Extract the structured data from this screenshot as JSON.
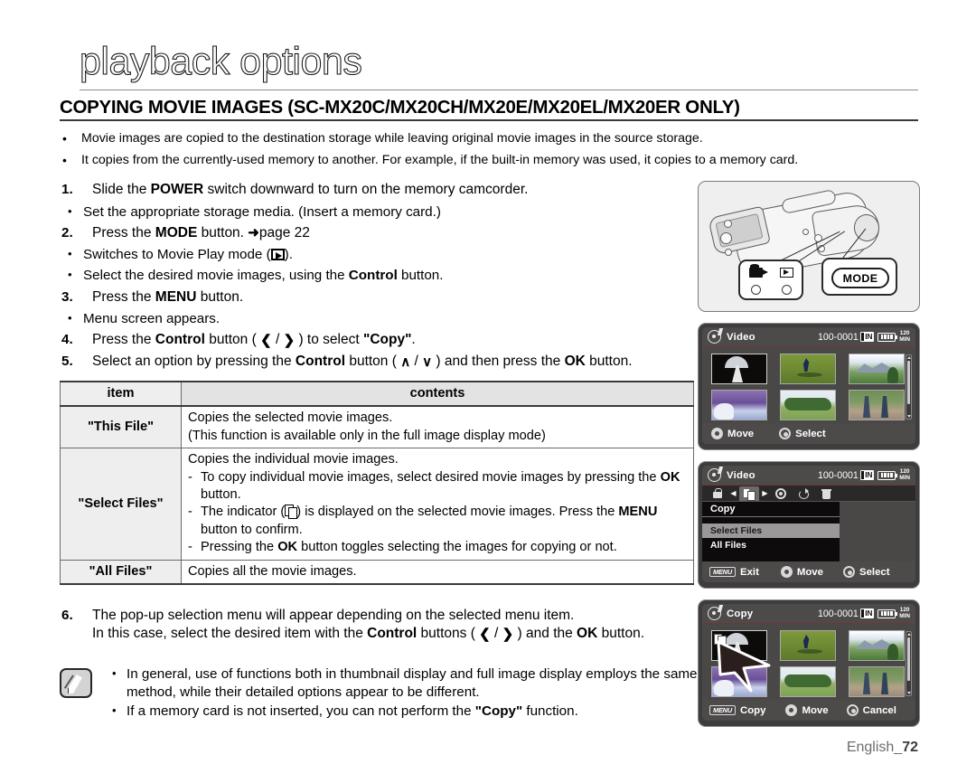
{
  "page": {
    "title": "playback options",
    "section_heading": "COPYING MOVIE IMAGES (SC-MX20C/MX20CH/MX20E/MX20EL/MX20ER ONLY)",
    "footer_lang": "English_",
    "footer_page": "72",
    "bullet": "•",
    "dash": "-"
  },
  "intro": {
    "items": [
      "Movie images are copied to the destination storage while leaving original movie images in the source storage.",
      "It copies from the currently-used memory to another. For example, if the built-in memory was used, it copies to a memory card."
    ]
  },
  "steps": {
    "s1": {
      "num": "1.",
      "pre": "Slide the ",
      "bold": "POWER",
      "post": " switch downward to turn on the memory camcorder.",
      "sub1": "Set the appropriate storage media. (Insert a memory card.)"
    },
    "s2": {
      "num": "2.",
      "pre": "Press the ",
      "bold": "MODE",
      "post": " button. ",
      "pageref": "page 22",
      "sub1_pre": "Switches to Movie Play mode (",
      "sub1_post": ").",
      "sub2_pre": "Select the desired movie images, using the ",
      "sub2_bold": "Control",
      "sub2_post": " button."
    },
    "s3": {
      "num": "3.",
      "pre": "Press the ",
      "bold": "MENU",
      "post": " button.",
      "sub1": "Menu screen appears."
    },
    "s4": {
      "num": "4.",
      "pre": "Press the ",
      "bold": "Control",
      "mid": " button ( ",
      "left_arrow": "❮",
      "slash": " / ",
      "right_arrow": "❯",
      "mid2": " ) to select ",
      "target": "\"Copy\"",
      "post": "."
    },
    "s5": {
      "num": "5.",
      "pre": "Select an option by pressing the ",
      "bold": "Control",
      "mid": " button ( ",
      "up_arrow": "∧",
      "slash": " / ",
      "down_arrow": "∨",
      "mid2": " ) and then press the ",
      "ok": "OK",
      "post": " button."
    },
    "s6": {
      "num": "6.",
      "line1": "The pop-up selection menu will appear depending on the selected menu item.",
      "l2_pre": "In this case, select the desired item with the ",
      "l2_bold": "Control",
      "l2_mid": " buttons ( ",
      "left_arrow": "❮",
      "slash": " / ",
      "right_arrow": "❯",
      "l2_mid2": " ) and the ",
      "l2_ok": "OK",
      "l2_post": " button."
    }
  },
  "table": {
    "headers": [
      "item",
      "contents"
    ],
    "rows": [
      {
        "item": "\"This File\"",
        "lines": [
          "Copies the selected movie images.",
          "(This function is available only in the full image display mode)"
        ]
      },
      {
        "item": "\"Select Files\"",
        "intro": "Copies the individual movie images.",
        "bullets": [
          {
            "pre": "To copy individual movie images, select desired movie images by pressing the ",
            "bold": "OK",
            "post": " button."
          },
          {
            "pre": "The indicator (",
            "icon": "copy-indicator-icon",
            "mid": ") is displayed on the selected movie images. Press the ",
            "bold": "MENU",
            "post": " button to confirm."
          },
          {
            "pre": "Pressing the ",
            "bold": "OK",
            "post": " button toggles selecting the images for copying or not."
          }
        ]
      },
      {
        "item": "\"All Files\"",
        "lines": [
          "Copies all the movie images."
        ]
      }
    ]
  },
  "note": {
    "icon": "note-pencil-icon",
    "items": [
      {
        "text": "In general, use of functions both in thumbnail display and full image display employs the same method, while their detailed options appear to be different."
      },
      {
        "pre": "If a memory card is not inserted, you can not perform the ",
        "bold": "\"Copy\"",
        "post": " function."
      }
    ]
  },
  "illustration": {
    "mode_button_label": "MODE",
    "mode_select_icons": [
      "movie-camera-icon",
      "play-icon"
    ]
  },
  "lcd_panels": [
    {
      "id": "video-thumbnail-screen",
      "title": "Video",
      "file_no": "100-0001",
      "badges": {
        "storage": "IN",
        "battery": "battery-full-icon",
        "time": "120",
        "time_unit": "MIN"
      },
      "footer": [
        {
          "icon": "joystick-icon",
          "label": "Move"
        },
        {
          "icon": "ok-button-icon",
          "label": "Select"
        }
      ]
    },
    {
      "id": "copy-menu-screen",
      "title": "Video",
      "file_no": "100-0001",
      "badges": {
        "storage": "IN",
        "battery": "battery-full-icon",
        "time": "120",
        "time_unit": "MIN"
      },
      "tabs": [
        "lock-icon",
        "copy-icon",
        "settings-gear-icon",
        "rotate-icon",
        "trash-icon"
      ],
      "menu_title": "Copy",
      "menu_items": [
        "Select Files",
        "All Files"
      ],
      "menu_selected": "Select Files",
      "footer": [
        {
          "icon": "menu-button-icon",
          "label": "Exit"
        },
        {
          "icon": "joystick-icon",
          "label": "Move"
        },
        {
          "icon": "ok-button-icon",
          "label": "Select"
        }
      ]
    },
    {
      "id": "copy-select-screen",
      "title": "Copy",
      "file_no": "100-0001",
      "badges": {
        "storage": "IN",
        "battery": "battery-full-icon",
        "time": "120",
        "time_unit": "MIN"
      },
      "footer": [
        {
          "icon": "menu-button-icon",
          "label": "Copy"
        },
        {
          "icon": "joystick-icon",
          "label": "Move"
        },
        {
          "icon": "ok-button-icon",
          "label": "Cancel"
        }
      ]
    }
  ]
}
